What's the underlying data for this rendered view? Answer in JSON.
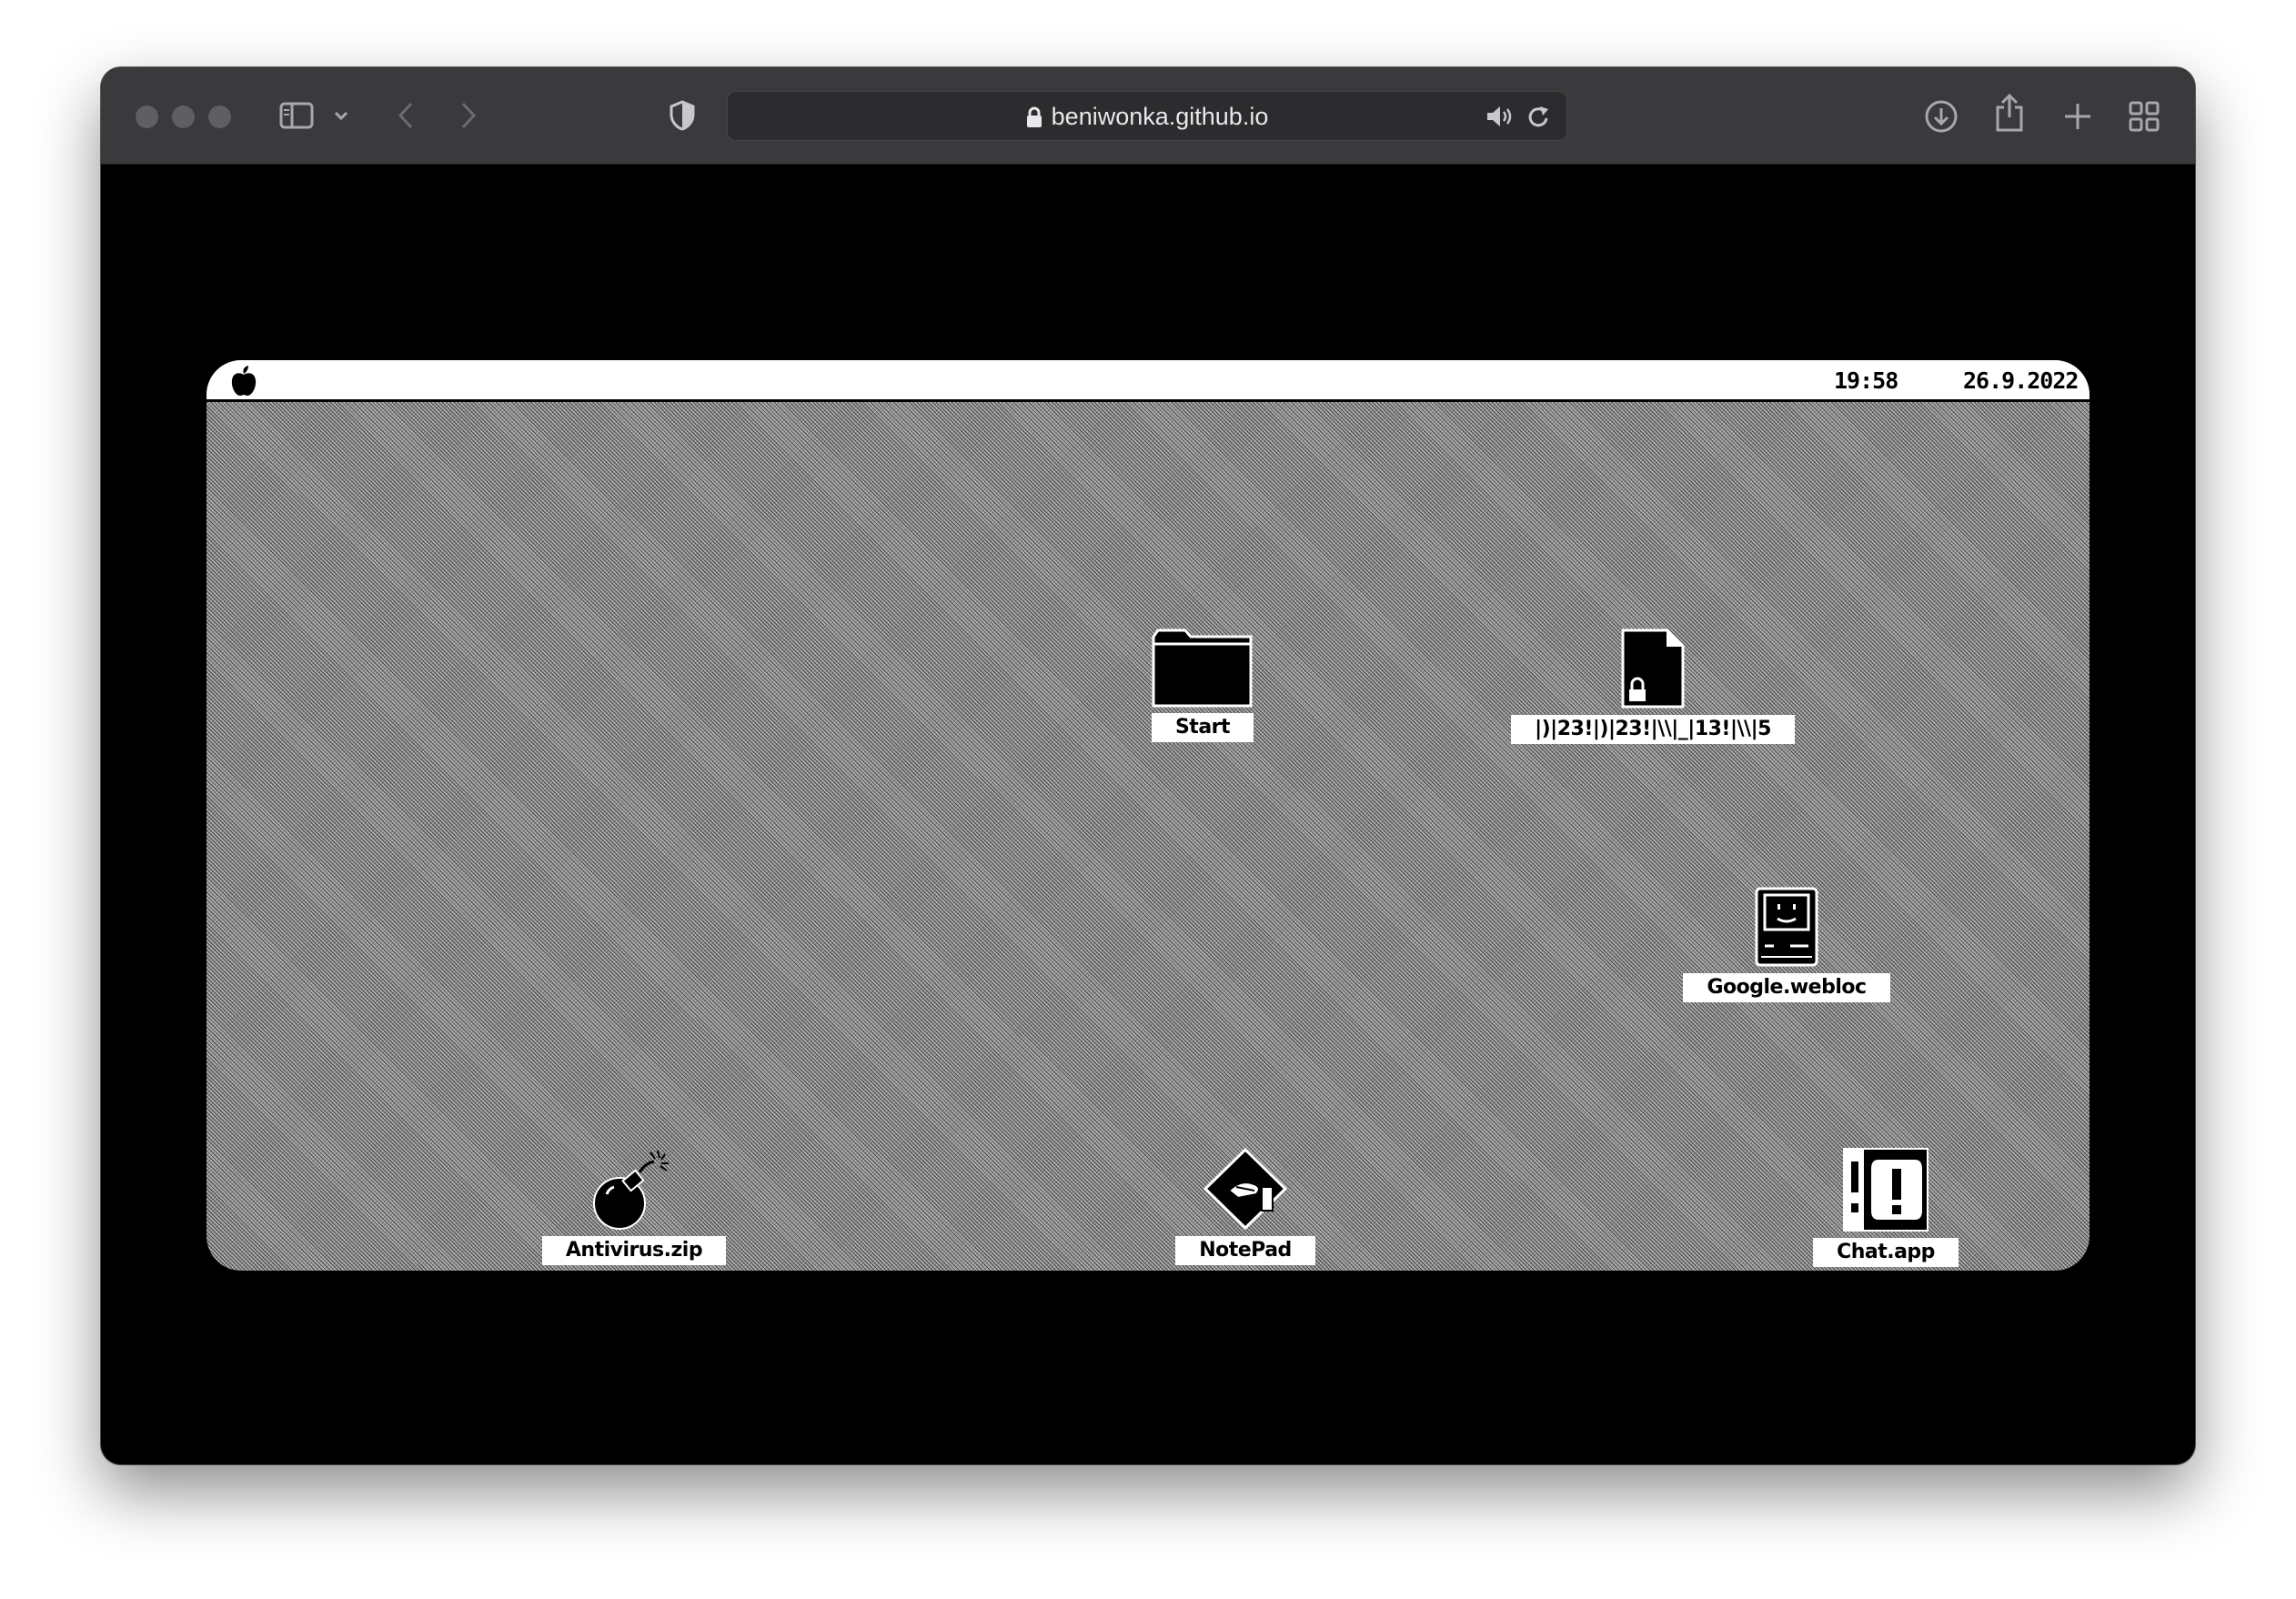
{
  "browser": {
    "url": "beniwonka.github.io",
    "icons": {
      "sidebar": "sidebar-icon",
      "back": "chevron-left-icon",
      "forward": "chevron-right-icon",
      "privacy": "shield-icon",
      "lock": "lock-icon",
      "audio": "speaker-icon",
      "reload": "reload-icon",
      "download": "download-icon",
      "share": "share-icon",
      "new_tab": "plus-icon",
      "tabs": "tab-overview-icon"
    }
  },
  "desktop": {
    "menubar": {
      "logo": "apple-logo",
      "time": "19:58",
      "date": "26.9.2022"
    },
    "icons": [
      {
        "label": "Start",
        "icon": "folder-icon"
      },
      {
        "label": "|)|23!|)|23!|\\\\|_|13!|\\\\|5",
        "icon": "locked-document-icon"
      },
      {
        "label": "Google.webloc",
        "icon": "happy-mac-icon"
      },
      {
        "label": "Antivirus.zip",
        "icon": "bomb-icon"
      },
      {
        "label": "NotePad",
        "icon": "notepad-icon"
      },
      {
        "label": "Chat.app",
        "icon": "chat-icon"
      }
    ]
  },
  "colors": {
    "toolbar": "#3a3a3c",
    "frame": "#000000",
    "menubar": "#ffffff",
    "desktop_pattern": "#999999"
  }
}
